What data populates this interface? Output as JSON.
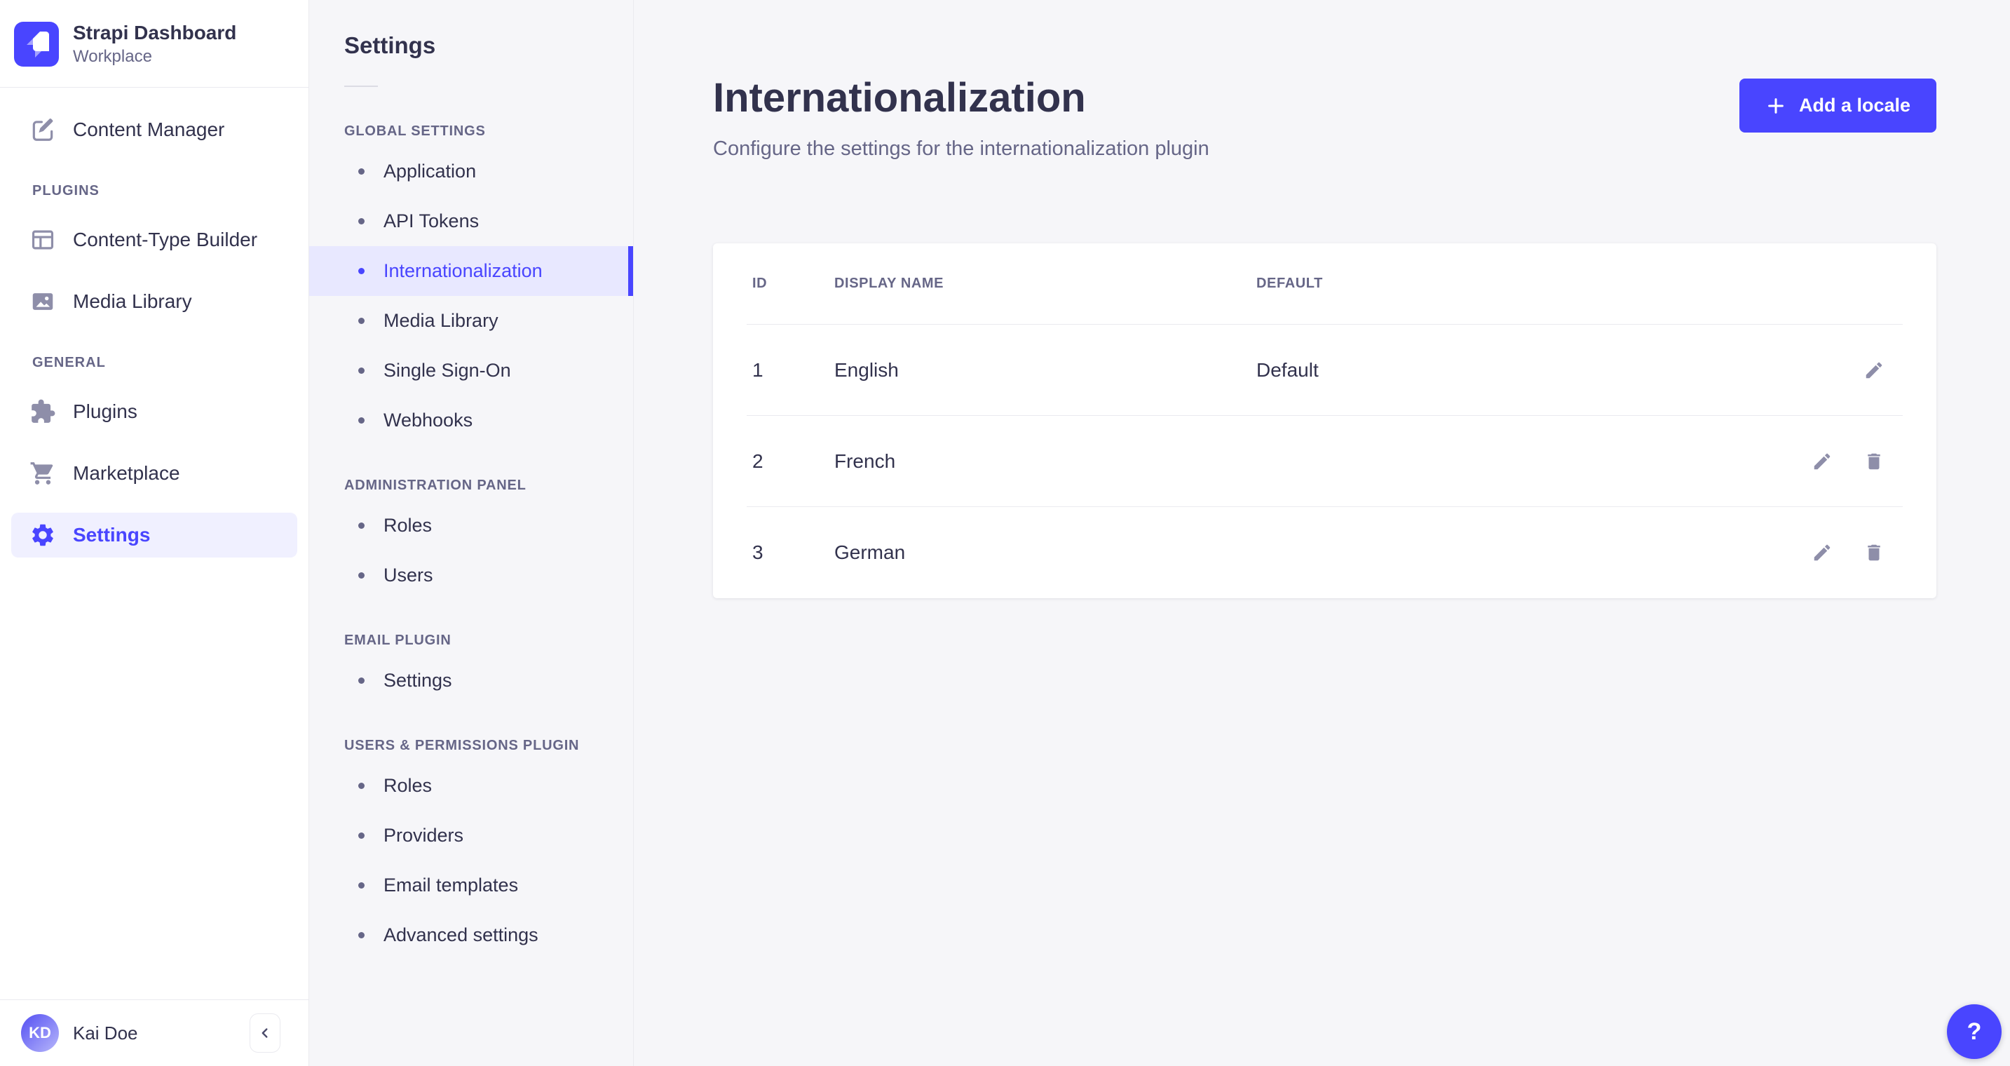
{
  "app": {
    "title": "Strapi Dashboard",
    "workspace": "Workplace"
  },
  "nav": {
    "content_manager": "Content Manager",
    "sections": [
      {
        "label": "PLUGINS",
        "items": [
          {
            "label": "Content-Type Builder",
            "icon": "layout-icon"
          },
          {
            "label": "Media Library",
            "icon": "image-icon"
          }
        ]
      },
      {
        "label": "GENERAL",
        "items": [
          {
            "label": "Plugins",
            "icon": "puzzle-icon"
          },
          {
            "label": "Marketplace",
            "icon": "cart-icon"
          },
          {
            "label": "Settings",
            "icon": "gear-icon",
            "active": true
          }
        ]
      }
    ],
    "user": {
      "initials": "KD",
      "name": "Kai Doe"
    }
  },
  "subnav": {
    "title": "Settings",
    "sections": [
      {
        "label": "GLOBAL SETTINGS",
        "items": [
          "Application",
          "API Tokens",
          "Internationalization",
          "Media Library",
          "Single Sign-On",
          "Webhooks"
        ],
        "active_index": 2
      },
      {
        "label": "ADMINISTRATION PANEL",
        "items": [
          "Roles",
          "Users"
        ]
      },
      {
        "label": "EMAIL PLUGIN",
        "items": [
          "Settings"
        ]
      },
      {
        "label": "USERS & PERMISSIONS PLUGIN",
        "items": [
          "Roles",
          "Providers",
          "Email templates",
          "Advanced settings"
        ]
      }
    ]
  },
  "main": {
    "title": "Internationalization",
    "subtitle": "Configure the settings for the internationalization plugin",
    "add_locale_button": "Add a locale",
    "table": {
      "headers": {
        "id": "ID",
        "display_name": "DISPLAY NAME",
        "default": "DEFAULT"
      },
      "rows": [
        {
          "id": "1",
          "display_name": "English",
          "default": "Default",
          "can_delete": false
        },
        {
          "id": "2",
          "display_name": "French",
          "default": "",
          "can_delete": true
        },
        {
          "id": "3",
          "display_name": "German",
          "default": "",
          "can_delete": true
        }
      ]
    }
  },
  "help": {
    "label": "?"
  },
  "colors": {
    "accent": "#4945ff",
    "accent_bg_selected": "#e8e8ff",
    "sidebar_selected_bg": "#f0f0ff",
    "text_dark": "#32324d",
    "text_gray": "#666687",
    "icon_gray": "#8e8ea9",
    "border": "#eaeaef",
    "page_bg": "#f6f6f9"
  }
}
